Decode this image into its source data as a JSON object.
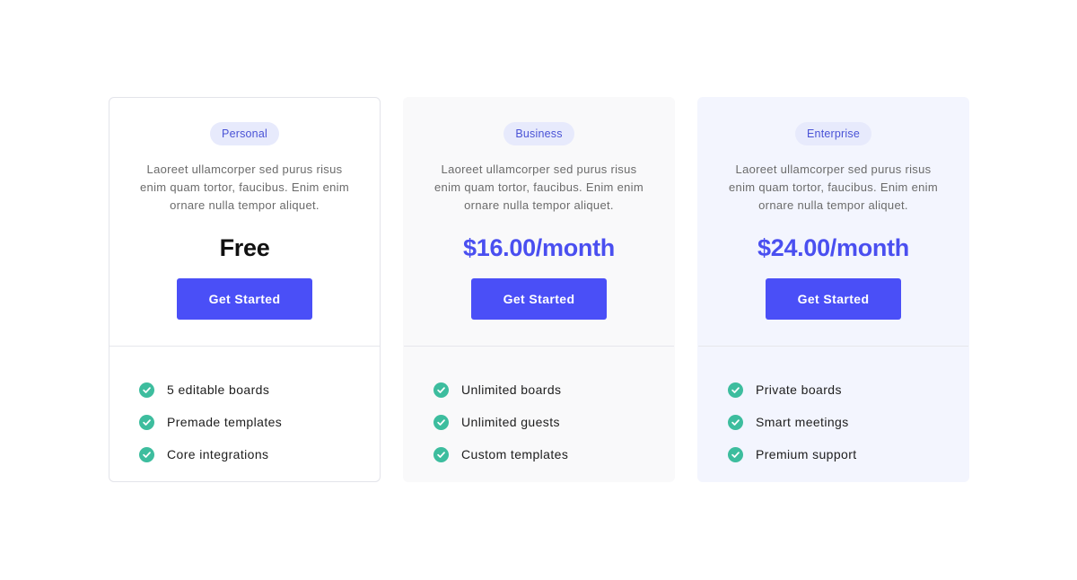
{
  "plans": [
    {
      "badge": "Personal",
      "description": "Laoreet ullamcorper sed purus risus enim quam tortor, faucibus. Enim enim ornare nulla tempor aliquet.",
      "price": "Free",
      "cta": "Get Started",
      "features": [
        "5 editable boards",
        "Premade templates",
        "Core integrations"
      ]
    },
    {
      "badge": "Business",
      "description": "Laoreet ullamcorper sed purus risus enim quam tortor, faucibus. Enim enim ornare nulla tempor aliquet.",
      "price": "$16.00/month",
      "cta": "Get Started",
      "features": [
        "Unlimited boards",
        "Unlimited guests",
        "Custom templates"
      ]
    },
    {
      "badge": "Enterprise",
      "description": "Laoreet ullamcorper sed purus risus enim quam tortor, faucibus. Enim enim ornare nulla tempor aliquet.",
      "price": "$24.00/month",
      "cta": "Get Started",
      "features": [
        "Private boards",
        "Smart meetings",
        "Premium support"
      ]
    }
  ],
  "icons": {
    "feature": "check-circle-icon"
  },
  "colors": {
    "accent": "#4a4ff7",
    "check": "#3dbd9e",
    "badge_bg": "#e7eafc",
    "badge_text": "#4a53d6",
    "business_bg": "#f9f9fa",
    "enterprise_bg": "#f3f5fe"
  }
}
